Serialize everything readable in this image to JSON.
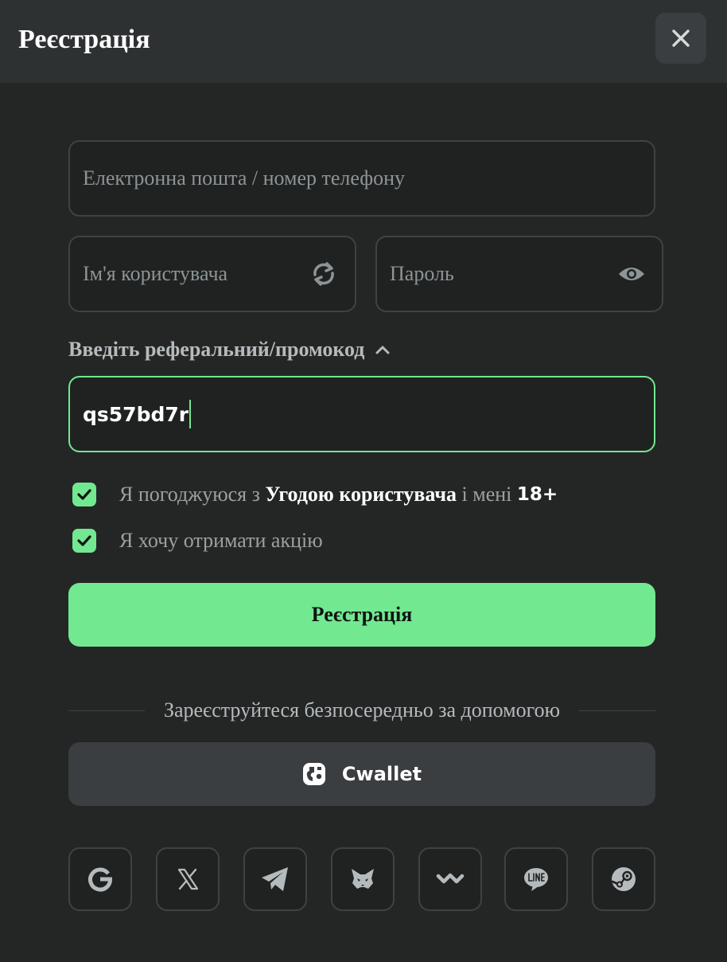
{
  "header": {
    "title": "Реєстрація",
    "close_icon": "close-icon"
  },
  "form": {
    "email_placeholder": "Електронна пошта / номер телефону",
    "username_placeholder": "Ім'я користувача",
    "password_placeholder": "Пароль",
    "promo_label": "Введіть реферальний/промокод",
    "promo_value": "qs57bd7r",
    "agree_prefix": "Я погоджуюся з",
    "agree_link": "Угодою користувача",
    "agree_middle": "і мені",
    "agree_age": "18+",
    "promo_opt_in": "Я хочу отримати акцію",
    "agree_checked": true,
    "promo_opt_in_checked": true,
    "submit_label": "Реєстрація"
  },
  "social": {
    "divider_text": "Зареєструйтеся безпосередньо за допомогою",
    "cwallet_label": "Cwallet",
    "providers": [
      "google-icon",
      "x-icon",
      "telegram-icon",
      "metamask-icon",
      "walletconnect-icon",
      "line-icon",
      "steam-icon"
    ]
  },
  "colors": {
    "accent": "#72e891",
    "background": "#242626",
    "header_bg": "#2e3132",
    "field_border": "#3d4245"
  }
}
